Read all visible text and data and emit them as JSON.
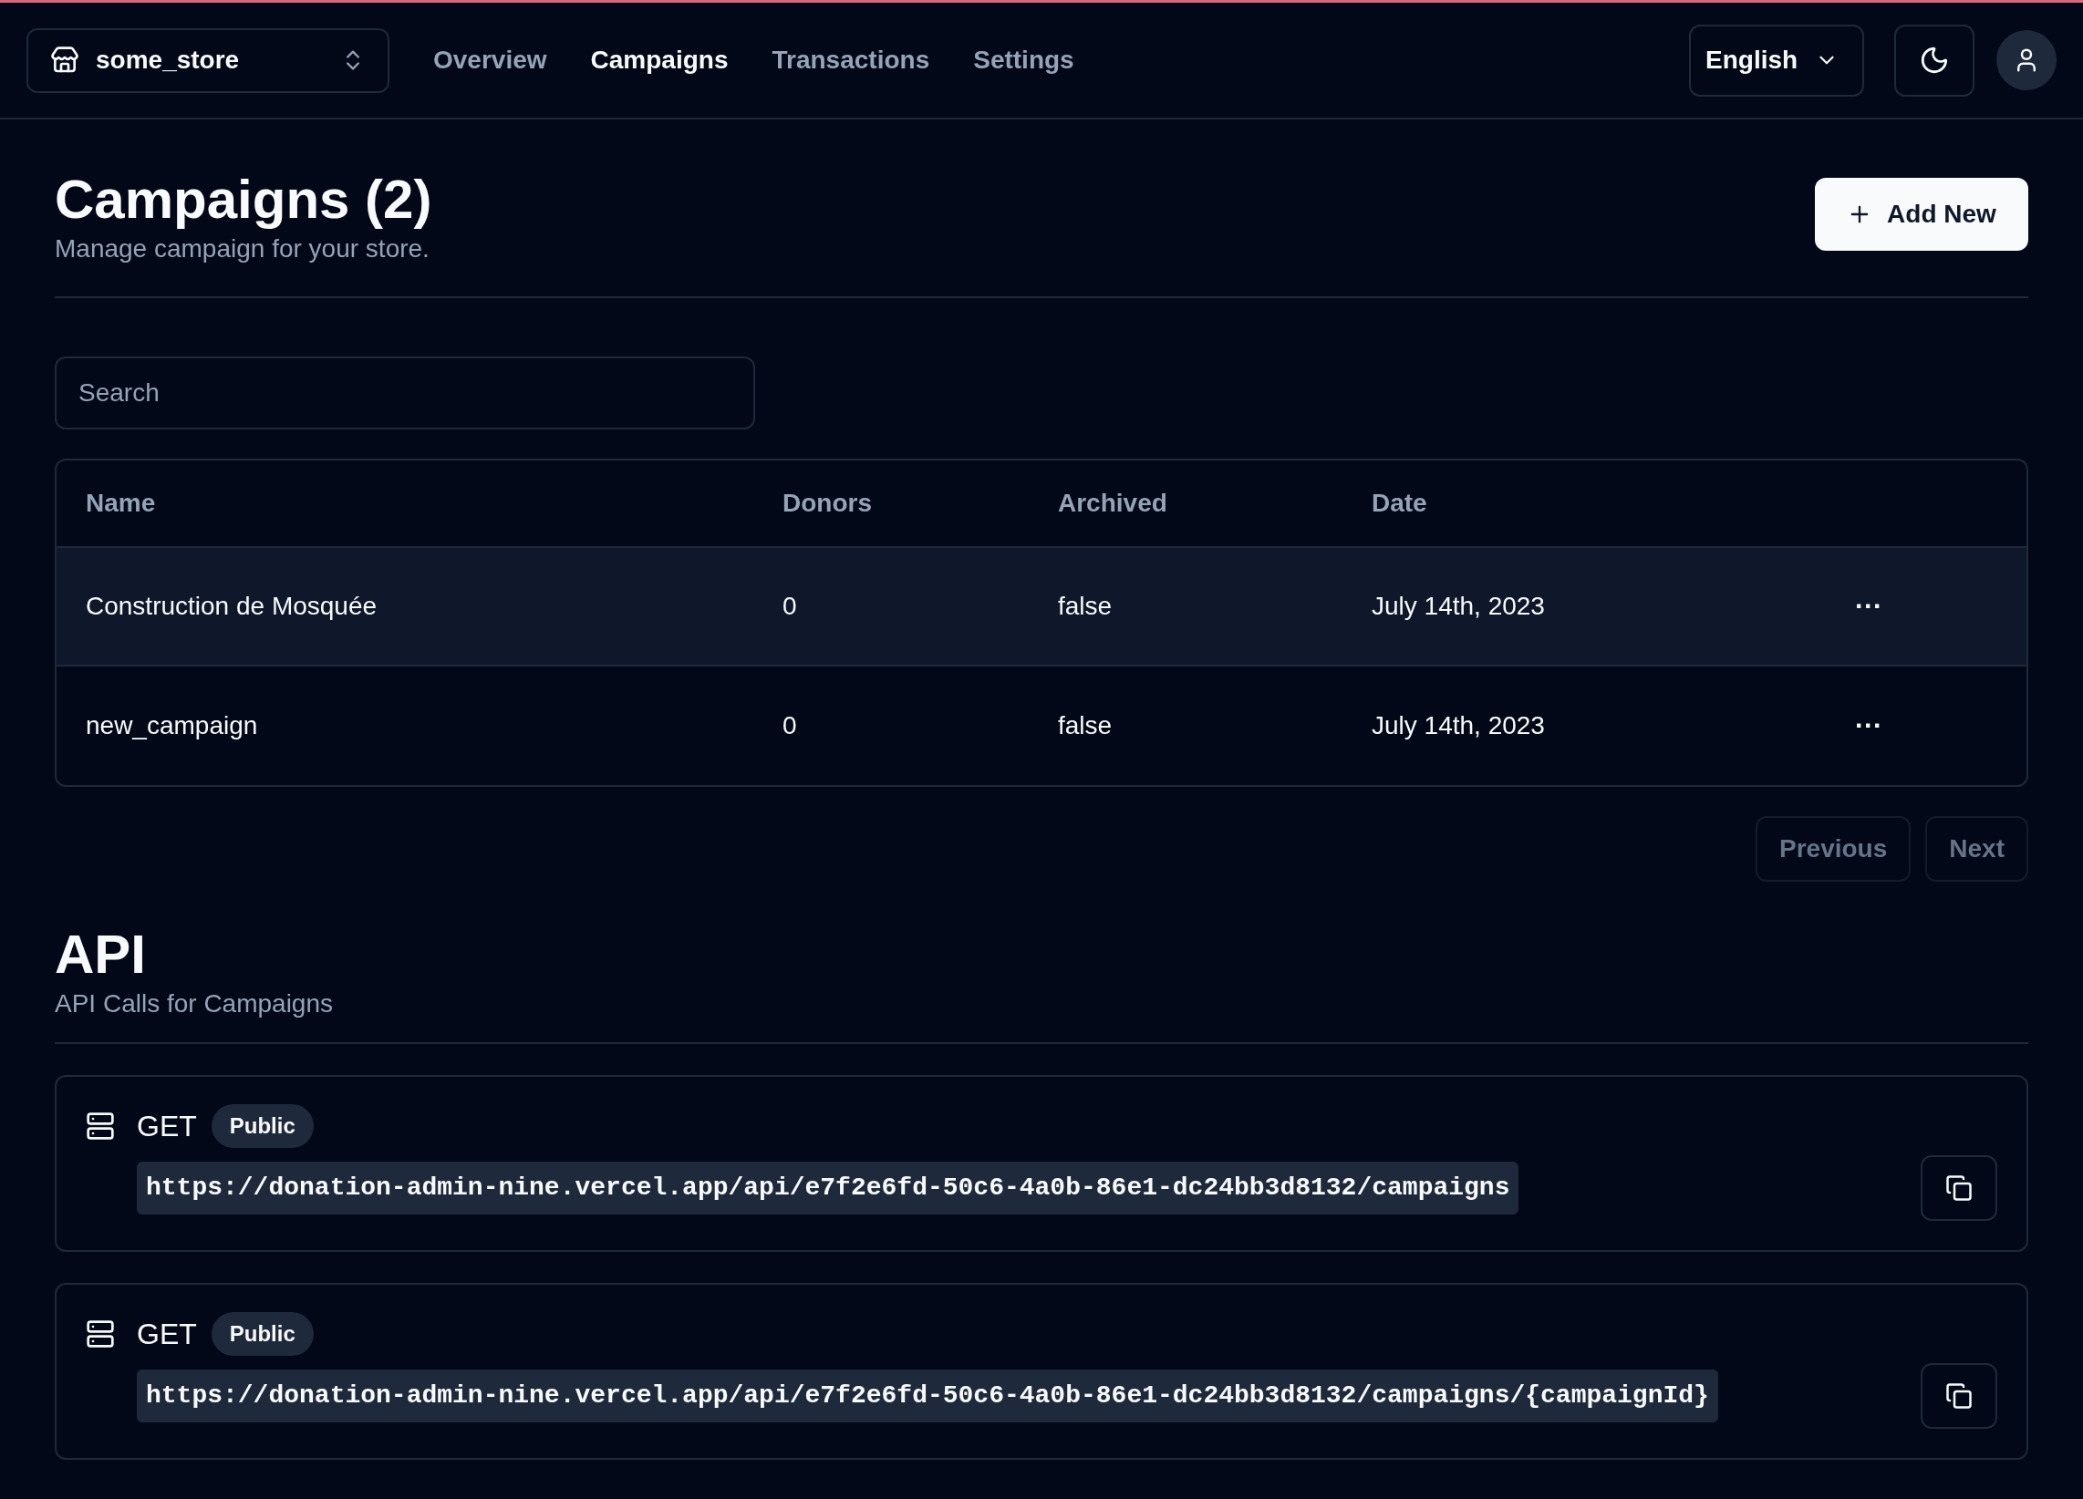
{
  "store_switcher": {
    "label": "some_store"
  },
  "nav": [
    {
      "label": "Overview",
      "selected": false
    },
    {
      "label": "Campaigns",
      "selected": true
    },
    {
      "label": "Transactions",
      "selected": false
    },
    {
      "label": "Settings",
      "selected": false
    }
  ],
  "language": {
    "label": "English"
  },
  "header": {
    "title": "Campaigns (2)",
    "subtitle": "Manage campaign for your store.",
    "add_button": "Add New"
  },
  "search": {
    "placeholder": "Search"
  },
  "table": {
    "columns": [
      "Name",
      "Donors",
      "Archived",
      "Date"
    ],
    "rows": [
      {
        "cells": [
          "Construction de Mosquée",
          "0",
          "false",
          "July 14th, 2023"
        ],
        "selected": true,
        "actions": "···"
      },
      {
        "cells": [
          "new_campaign",
          "0",
          "false",
          "July 14th, 2023"
        ],
        "selected": false,
        "actions": "···"
      }
    ]
  },
  "pagination": [
    {
      "label": "Previous",
      "disabled": true
    },
    {
      "label": "Next",
      "disabled": true
    }
  ],
  "api": {
    "title": "API",
    "subtitle": "API Calls for Campaigns",
    "endpoints": [
      {
        "method": "GET",
        "badge": "Public",
        "url": "https://donation-admin-nine.vercel.app/api/e7f2e6fd-50c6-4a0b-86e1-dc24bb3d8132/campaigns"
      },
      {
        "method": "GET",
        "badge": "Public",
        "url": "https://donation-admin-nine.vercel.app/api/e7f2e6fd-50c6-4a0b-86e1-dc24bb3d8132/campaigns/{campaignId}"
      }
    ]
  }
}
